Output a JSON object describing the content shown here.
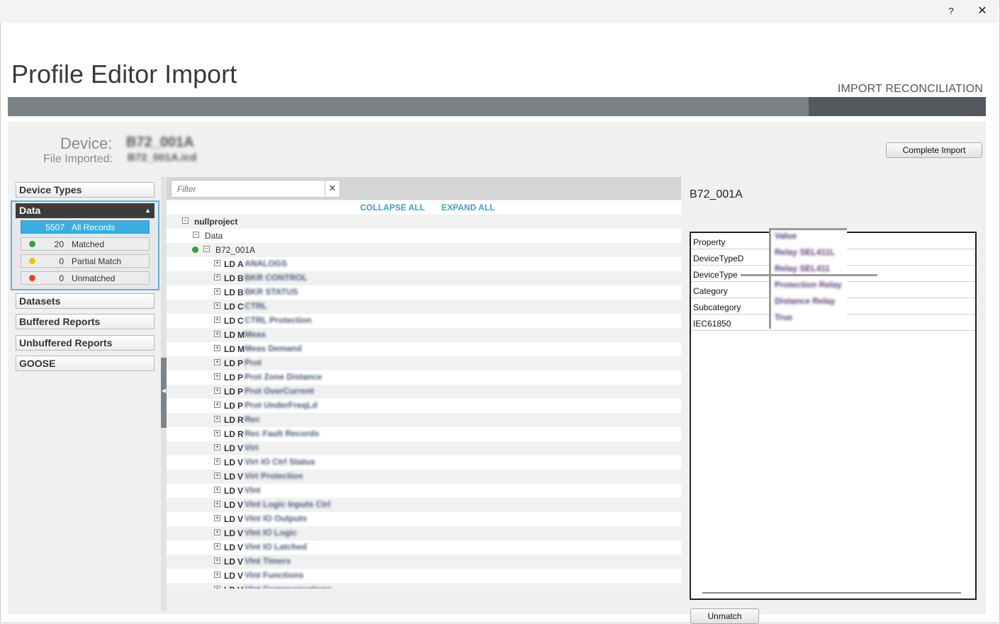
{
  "window": {
    "help_label": "?",
    "close_label": "✕"
  },
  "header": {
    "title": "Profile Editor Import",
    "step_label": "IMPORT RECONCILIATION"
  },
  "device": {
    "device_label": "Device:",
    "device_value": "B72_001A",
    "file_label": "File Imported:",
    "file_value": "B72_001A.icd"
  },
  "complete_button": "Complete Import",
  "sidebar": {
    "device_types": "Device Types",
    "data": "Data",
    "records": [
      {
        "count": "5507",
        "label": "All Records",
        "color": ""
      },
      {
        "count": "20",
        "label": "Matched",
        "color": "#2fa43a"
      },
      {
        "count": "0",
        "label": "Partial Match",
        "color": "#f2c200"
      },
      {
        "count": "0",
        "label": "Unmatched",
        "color": "#e8431f"
      }
    ],
    "datasets": "Datasets",
    "buffered": "Buffered Reports",
    "unbuffered": "Unbuffered Reports",
    "goose": "GOOSE"
  },
  "filter": {
    "placeholder": "Filter",
    "clear": "✕"
  },
  "tree_actions": {
    "collapse": "COLLAPSE ALL",
    "expand": "EXPAND ALL"
  },
  "tree": {
    "root": "nullproject",
    "data": "Data",
    "device": "B72_001A",
    "ld_prefix": "LD",
    "ld_items": [
      {
        "letter": "A",
        "name": "ANALOGS"
      },
      {
        "letter": "B",
        "name": "BKR CONTROL"
      },
      {
        "letter": "B",
        "name": "BKR STATUS"
      },
      {
        "letter": "C",
        "name": "CTRL"
      },
      {
        "letter": "C",
        "name": "CTRL Protection"
      },
      {
        "letter": "M",
        "name": "Meas"
      },
      {
        "letter": "M",
        "name": "Meas Demand"
      },
      {
        "letter": "P",
        "name": "Prot"
      },
      {
        "letter": "P",
        "name": "Prot Zone Distance"
      },
      {
        "letter": "P",
        "name": "Prot OverCurrent"
      },
      {
        "letter": "P",
        "name": "Prot UnderFreqLd"
      },
      {
        "letter": "R",
        "name": "Rec"
      },
      {
        "letter": "R",
        "name": "Rec Fault Records"
      },
      {
        "letter": "V",
        "name": "Virt"
      },
      {
        "letter": "V",
        "name": "Virt IO Ctrl Status"
      },
      {
        "letter": "V",
        "name": "Virt Protection"
      },
      {
        "letter": "V",
        "name": "VInt"
      },
      {
        "letter": "V",
        "name": "VInt Logic Inputs Ctrl"
      },
      {
        "letter": "V",
        "name": "VInt IO Outputs"
      },
      {
        "letter": "V",
        "name": "VInt IO Logic"
      },
      {
        "letter": "V",
        "name": "VInt IO Latched"
      },
      {
        "letter": "V",
        "name": "VInt Timers"
      },
      {
        "letter": "V",
        "name": "VInt Functions"
      },
      {
        "letter": "V",
        "name": "VInt Communications"
      }
    ]
  },
  "right_panel": {
    "title": "B72_001A",
    "properties": [
      {
        "name": "Property",
        "value": "Value"
      },
      {
        "name": "DeviceTypeD",
        "value": "Relay SEL411L"
      },
      {
        "name": "DeviceType",
        "value": "Relay SEL411"
      },
      {
        "name": "Category",
        "value": "Protection Relay"
      },
      {
        "name": "Subcategory",
        "value": "Distance Relay"
      },
      {
        "name": "IEC61850",
        "value": "True"
      }
    ],
    "unmatch_button": "Unmatch"
  }
}
